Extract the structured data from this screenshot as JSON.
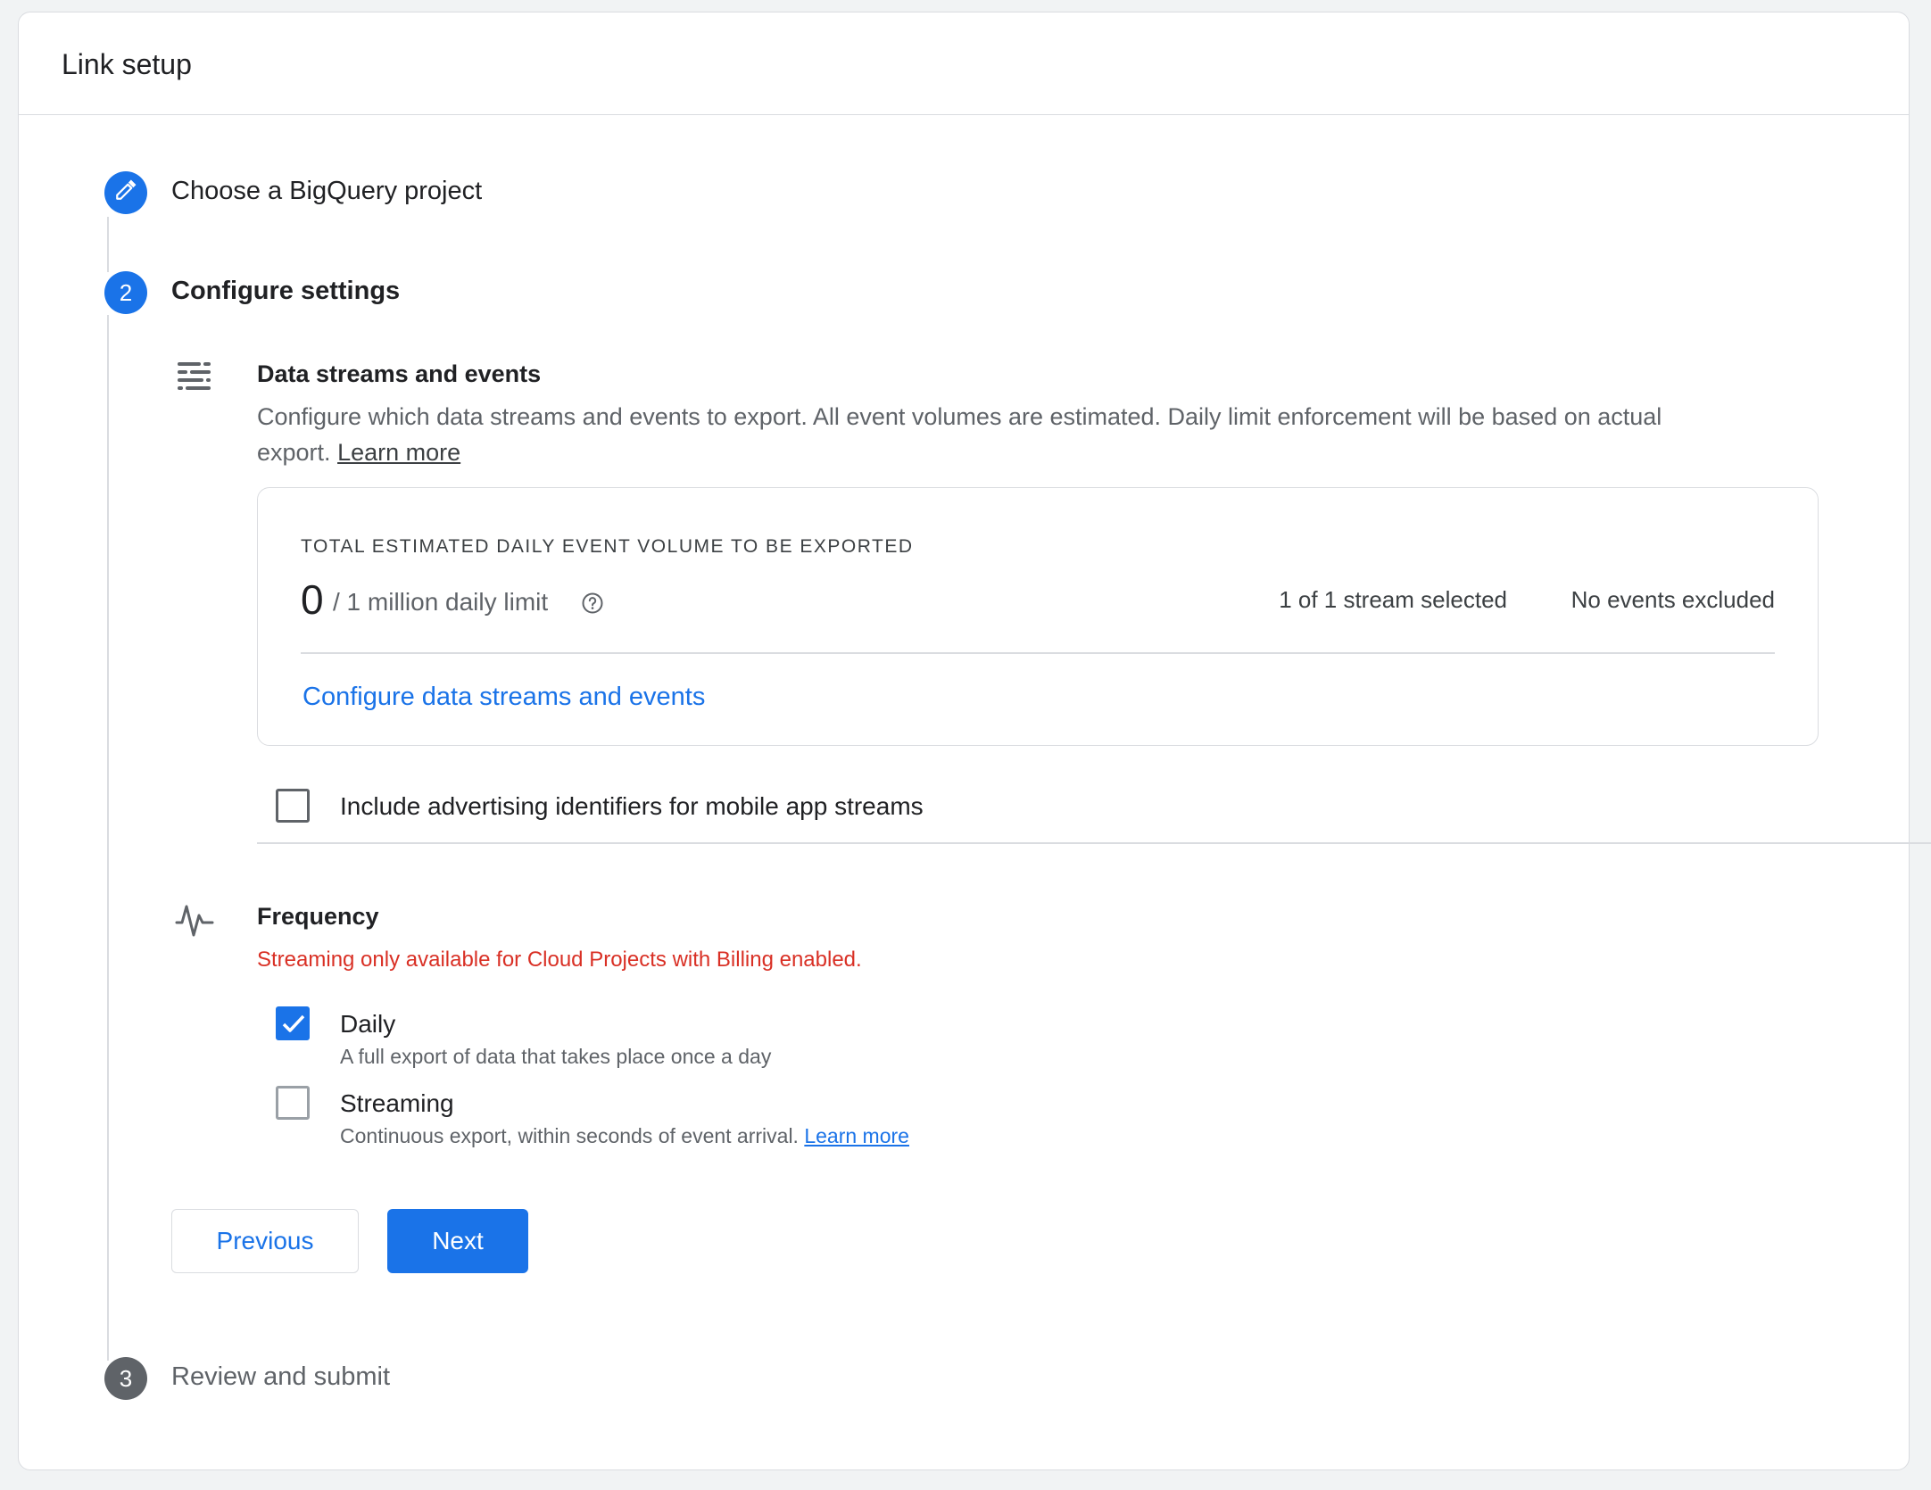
{
  "header": {
    "title": "Link setup"
  },
  "steps": [
    {
      "number": "",
      "label": "Choose a BigQuery project",
      "state": "edit"
    },
    {
      "number": "2",
      "label": "Configure settings",
      "state": "active"
    },
    {
      "number": "3",
      "label": "Review and submit",
      "state": "pending"
    }
  ],
  "data_streams": {
    "title": "Data streams and events",
    "description": "Configure which data streams and events to export. All event volumes are estimated. Daily limit enforcement will be based on actual export.",
    "learn_more": "Learn more",
    "volume": {
      "heading": "TOTAL ESTIMATED DAILY EVENT VOLUME TO BE EXPORTED",
      "count": "0",
      "limit": "/ 1 million daily limit",
      "streams_selected": "1 of 1 stream selected",
      "events_excluded": "No events excluded",
      "configure_link": "Configure data streams and events"
    },
    "ad_identifiers": {
      "label": "Include advertising identifiers for mobile app streams",
      "checked": false
    }
  },
  "frequency": {
    "title": "Frequency",
    "warning": "Streaming only available for Cloud Projects with Billing enabled.",
    "options": [
      {
        "label": "Daily",
        "description": "A full export of data that takes place once a day",
        "checked": true
      },
      {
        "label": "Streaming",
        "description": "Continuous export, within seconds of event arrival.",
        "link": "Learn more",
        "checked": false
      }
    ]
  },
  "buttons": {
    "previous": "Previous",
    "next": "Next"
  },
  "colors": {
    "accent": "#1a73e8",
    "error": "#d93025",
    "muted": "#5f6368"
  }
}
